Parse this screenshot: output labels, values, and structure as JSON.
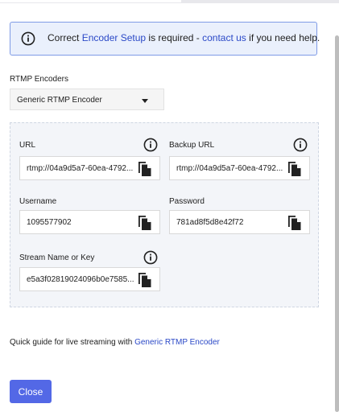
{
  "banner": {
    "prefix": "Correct ",
    "link1": "Encoder Setup",
    "middle": " is required - ",
    "link2": "contact us",
    "suffix": " if you need help."
  },
  "encoders": {
    "label": "RTMP Encoders",
    "selected": "Generic RTMP Encoder"
  },
  "fields": {
    "url": {
      "label": "URL",
      "value": "rtmp://04a9d5a7-60ea-4792..."
    },
    "backup_url": {
      "label": "Backup URL",
      "value": "rtmp://04a9d5a7-60ea-4792..."
    },
    "username": {
      "label": "Username",
      "value": "1095577902"
    },
    "password": {
      "label": "Password",
      "value": "781ad8f5d8e42f72"
    },
    "stream_key": {
      "label": "Stream Name or Key",
      "value": "e5a3f02819024096b0e7585..."
    }
  },
  "guide": {
    "prefix": "Quick guide for live streaming with ",
    "link": "Generic RTMP Encoder"
  },
  "close_label": "Close",
  "colors": {
    "accent": "#5368e6",
    "link": "#2b49c7",
    "banner_bg": "#eaf0fc",
    "banner_border": "#7f9be6"
  }
}
